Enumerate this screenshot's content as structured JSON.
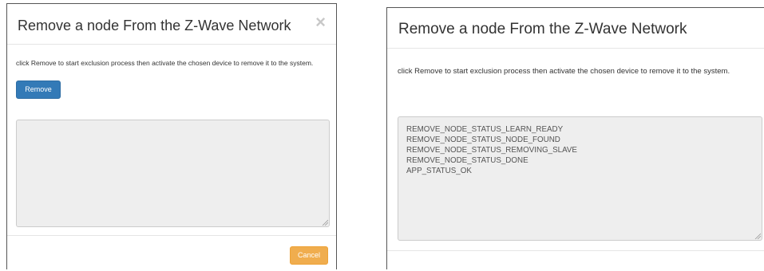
{
  "left_dialog": {
    "title": "Remove a node From the Z-Wave Network",
    "close_symbol": "×",
    "description": "click Remove to start exclusion process then activate the chosen device to remove it to the system.",
    "remove_button": "Remove",
    "log_text": "",
    "cancel_button": "Cancel"
  },
  "right_dialog": {
    "title": "Remove a node From the Z-Wave Network",
    "description": "click Remove to start exclusion process then activate the chosen device to remove it to the system.",
    "log_text": "REMOVE_NODE_STATUS_LEARN_READY\nREMOVE_NODE_STATUS_NODE_FOUND\nREMOVE_NODE_STATUS_REMOVING_SLAVE\nREMOVE_NODE_STATUS_DONE\nAPP_STATUS_OK"
  },
  "colors": {
    "primary": "#337ab7",
    "warning": "#f0ad4e",
    "log_background": "#eeeeee"
  },
  "icons": {
    "close": "close-icon",
    "resize": "resize-grip-icon"
  }
}
